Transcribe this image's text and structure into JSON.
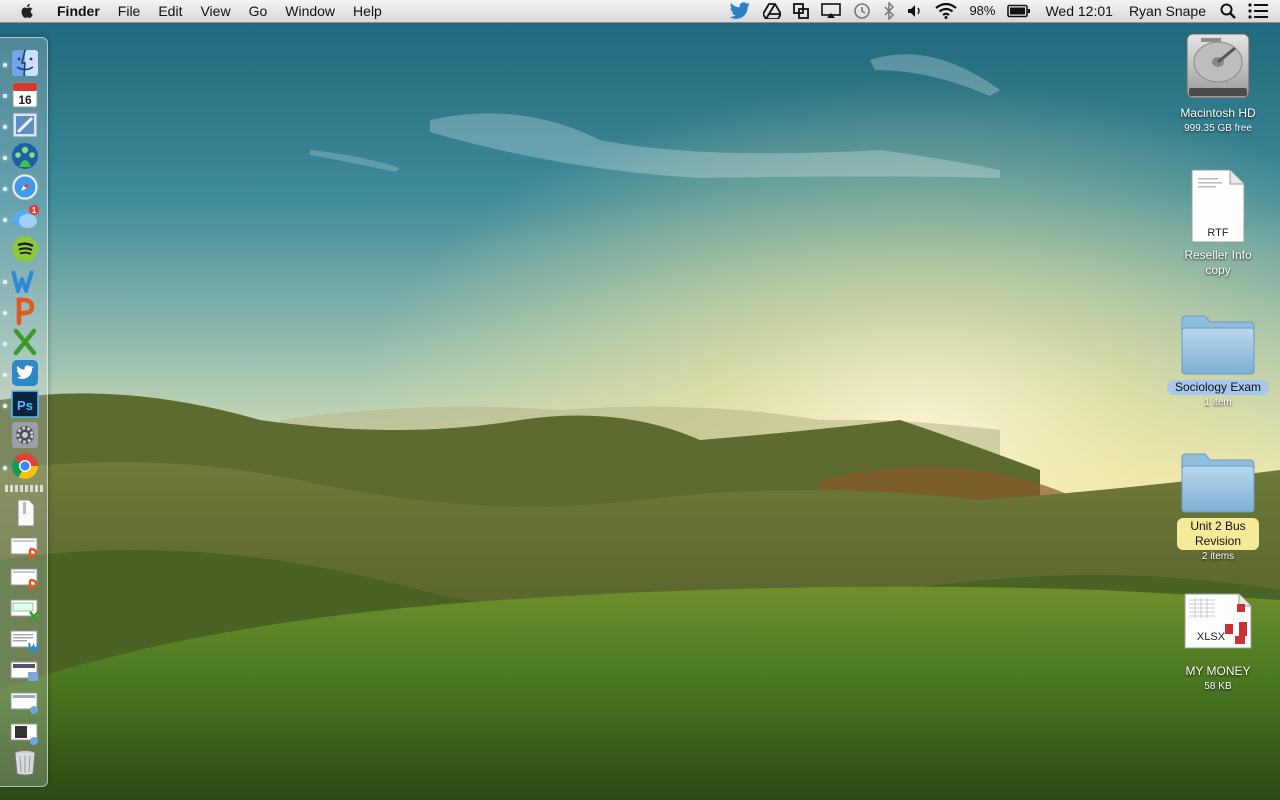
{
  "menubar": {
    "app_name": "Finder",
    "menus": [
      "File",
      "Edit",
      "View",
      "Go",
      "Window",
      "Help"
    ],
    "battery_percent": "98%",
    "clock": "Wed 12:01",
    "user_name": "Ryan Snape"
  },
  "desktop": {
    "items": [
      {
        "name": "Macintosh HD",
        "info": "999.35 GB free"
      },
      {
        "name": "Reseller Info copy",
        "badge": "RTF"
      },
      {
        "name": "Sociology Exam",
        "info": "1 item"
      },
      {
        "name": "Unit 2 Bus Revision",
        "info": "2 items"
      },
      {
        "name": "MY MONEY",
        "badge": "XLSX",
        "info": "58 KB"
      }
    ]
  },
  "dock": {
    "calendar_day": "16",
    "photoshop_label": "Ps",
    "messages_badge": "1"
  }
}
